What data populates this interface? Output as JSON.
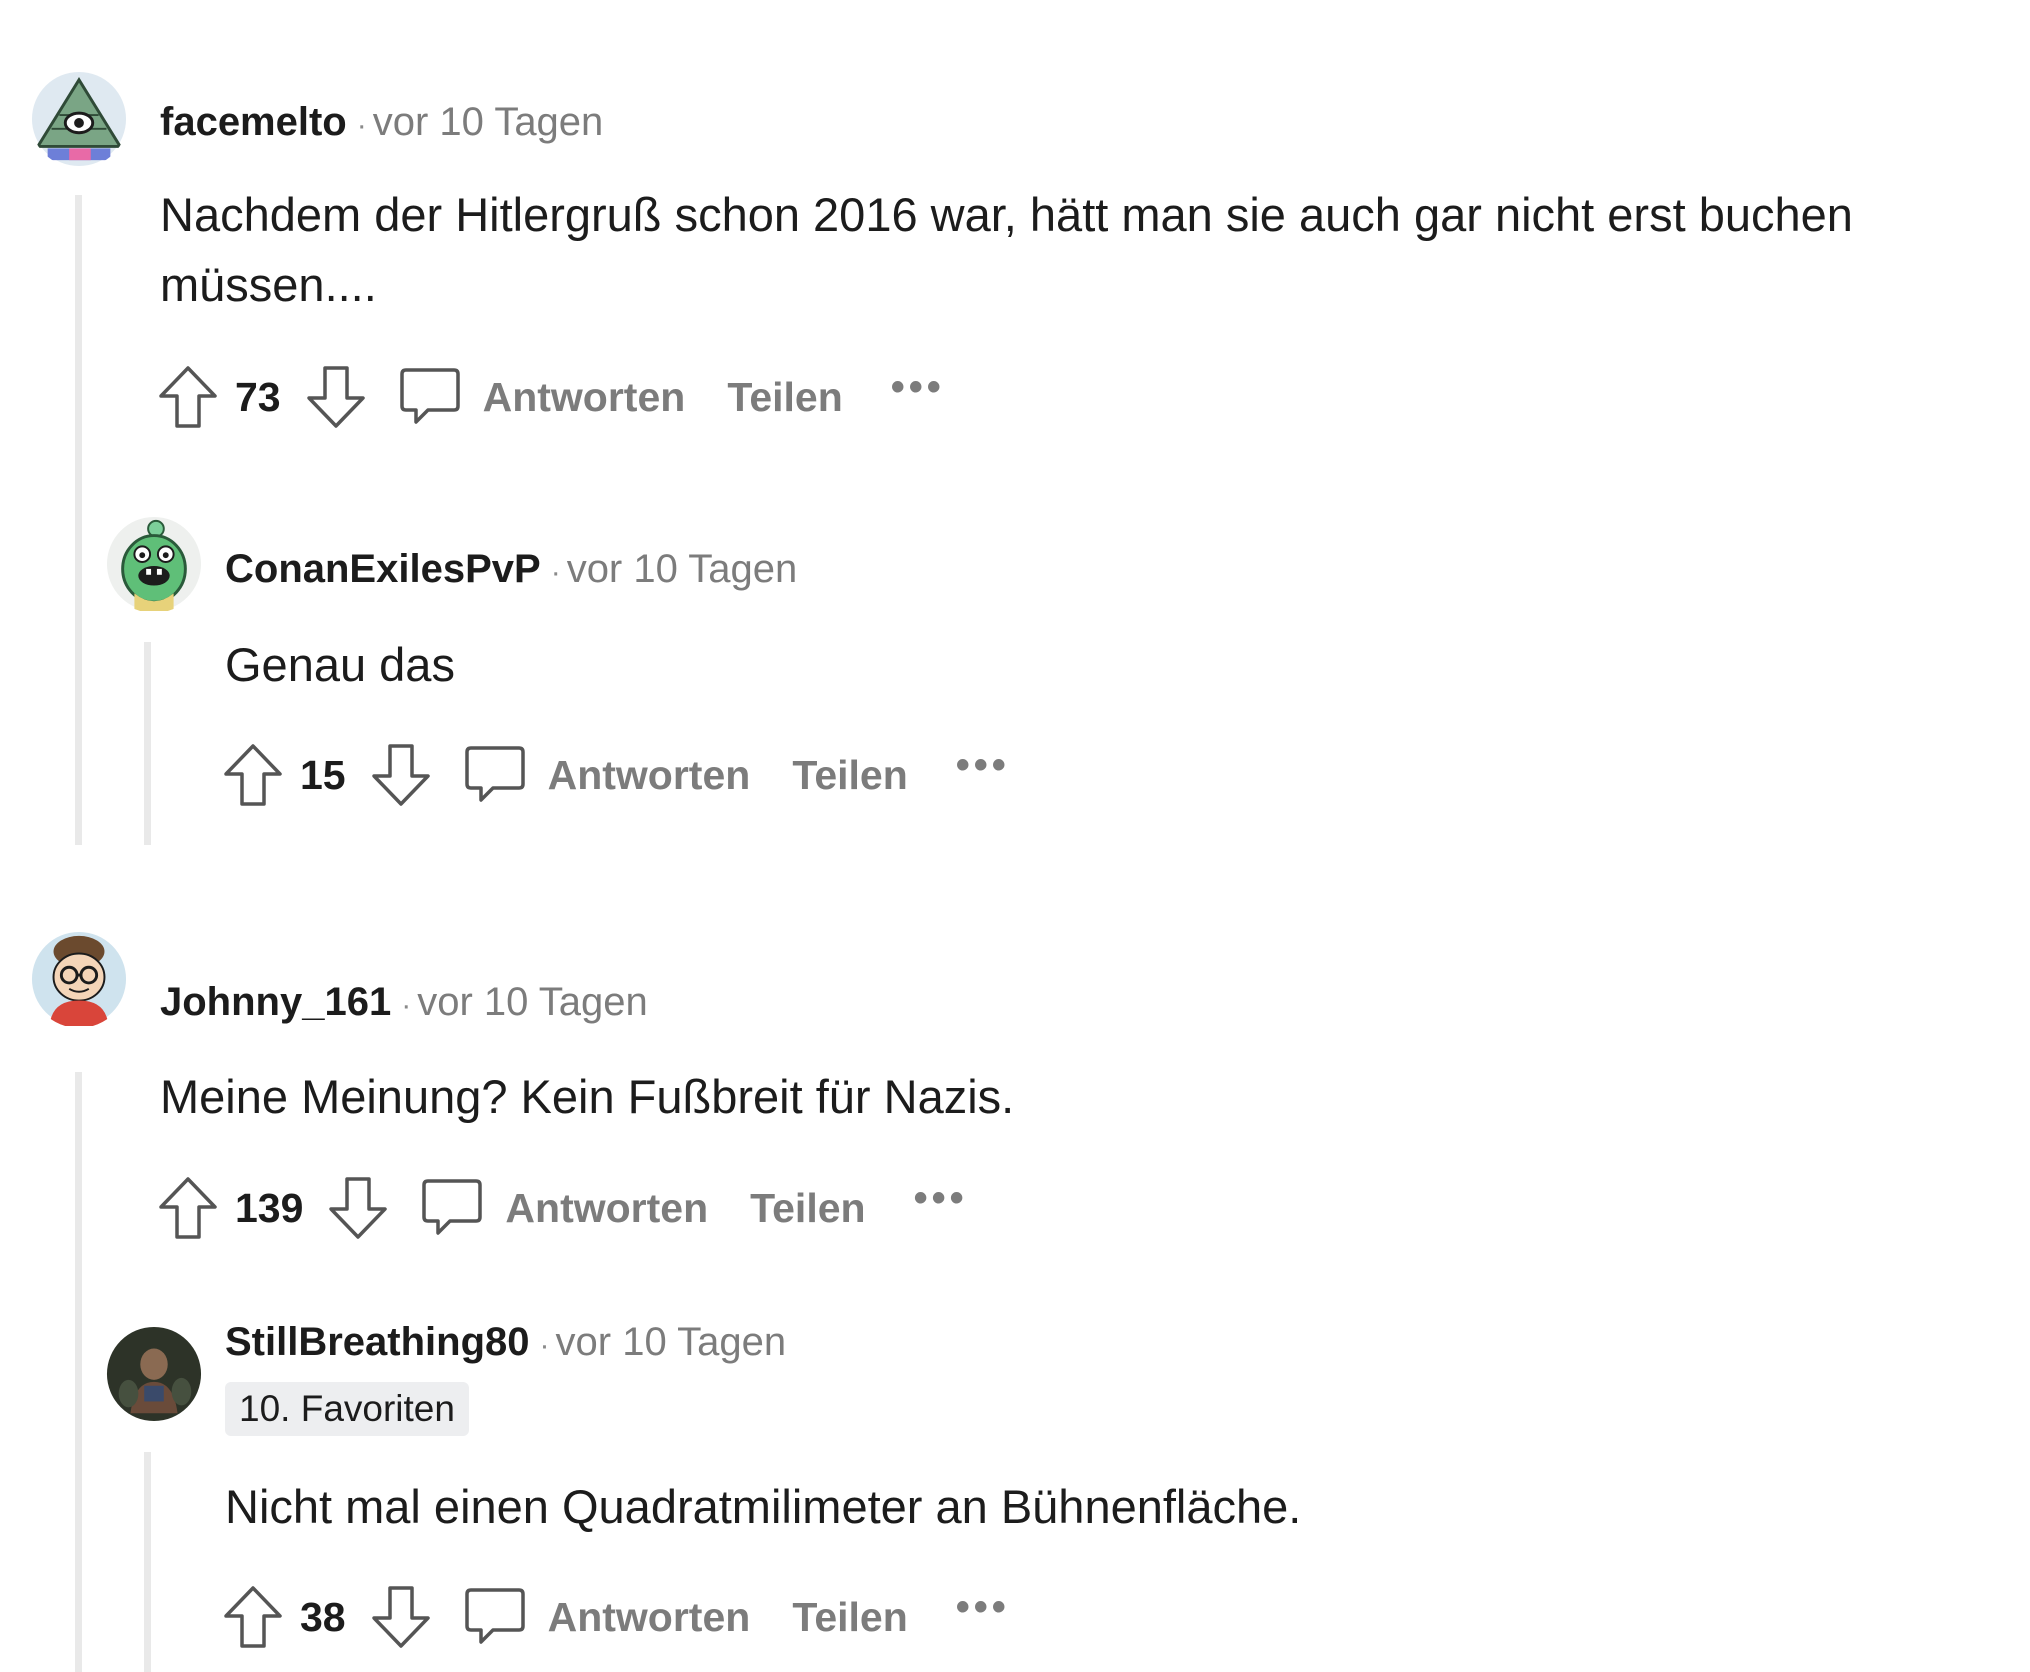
{
  "comments": [
    {
      "username": "facemelto",
      "separator": "·",
      "time": "vor 10 Tagen",
      "body": "Nachdem der Hitlergruß schon 2016 war, hätt man sie auch gar nicht erst buchen müssen....",
      "score": "73",
      "reply_label": "Antworten",
      "share_label": "Teilen",
      "more_label": "•••",
      "avatar_icon": "pyramid-eye-avatar-icon",
      "replies": [
        {
          "username": "ConanExilesPvP",
          "separator": "·",
          "time": "vor 10 Tagen",
          "body": "Genau das",
          "score": "15",
          "reply_label": "Antworten",
          "share_label": "Teilen",
          "more_label": "•••",
          "avatar_icon": "green-monster-avatar-icon"
        }
      ]
    },
    {
      "username": "Johnny_161",
      "separator": "·",
      "time": "vor 10 Tagen",
      "body": "Meine Meinung? Kein Fußbreit für Nazis.",
      "score": "139",
      "reply_label": "Antworten",
      "share_label": "Teilen",
      "more_label": "•••",
      "avatar_icon": "glasses-person-avatar-icon",
      "replies": [
        {
          "username": "StillBreathing80",
          "separator": "·",
          "time": "vor 10 Tagen",
          "flair": "10. Favoriten",
          "body": "Nicht mal einen Quadratmilimeter an Bühnenfläche.",
          "score": "38",
          "reply_label": "Antworten",
          "share_label": "Teilen",
          "more_label": "•••",
          "avatar_icon": "photo-avatar-icon"
        }
      ]
    }
  ],
  "colors": {
    "text": "#1c1c1c",
    "muted": "#7c7c7c",
    "thread_line": "#e9e9e9",
    "flair_bg": "#edeef0"
  }
}
